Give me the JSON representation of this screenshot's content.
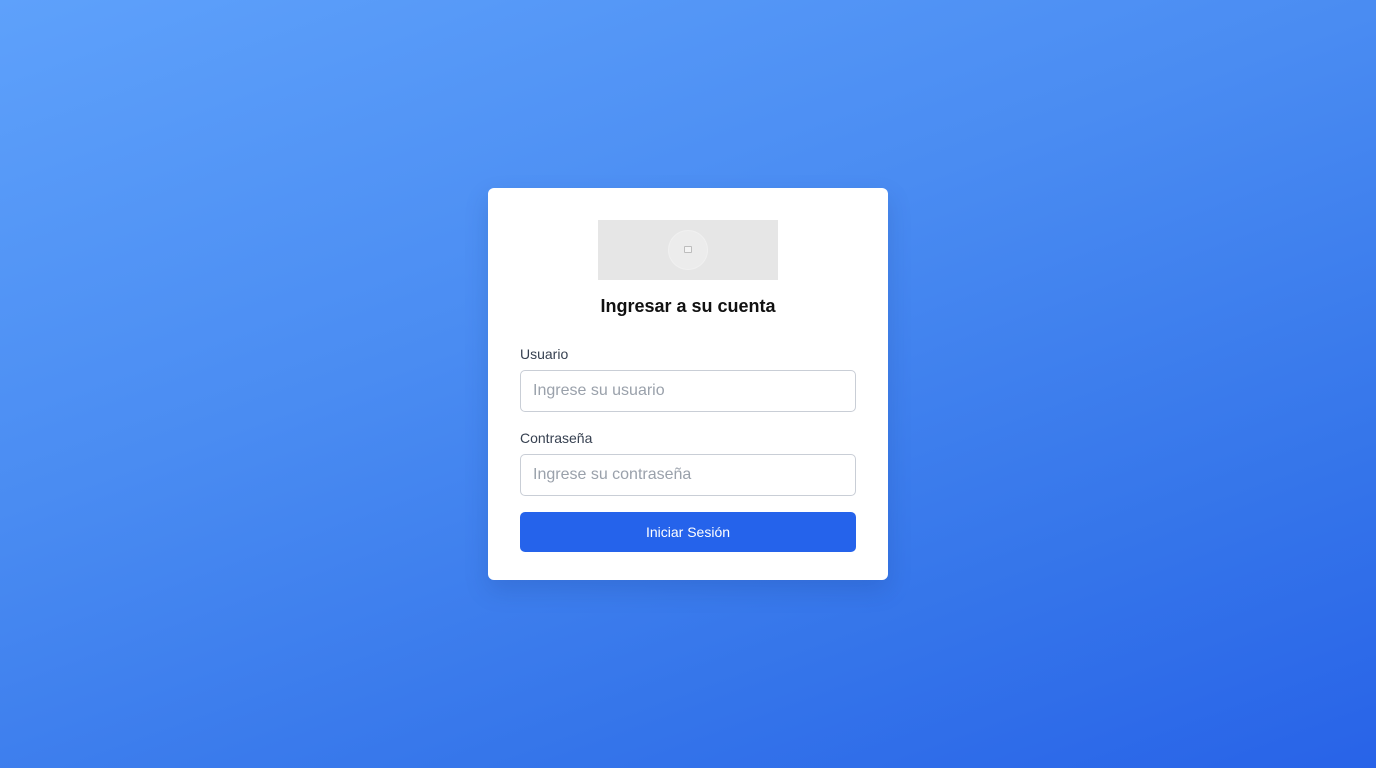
{
  "login": {
    "logo_icon": "image-placeholder-icon",
    "title": "Ingresar a su cuenta",
    "username": {
      "label": "Usuario",
      "placeholder": "Ingrese su usuario",
      "value": ""
    },
    "password": {
      "label": "Contraseña",
      "placeholder": "Ingrese su contraseña",
      "value": ""
    },
    "submit_label": "Iniciar Sesión"
  },
  "colors": {
    "background_start": "#5ea1fb",
    "background_end": "#2863e8",
    "card": "#ffffff",
    "primary_button": "#2563eb",
    "logo_placeholder": "#e6e6e6"
  }
}
